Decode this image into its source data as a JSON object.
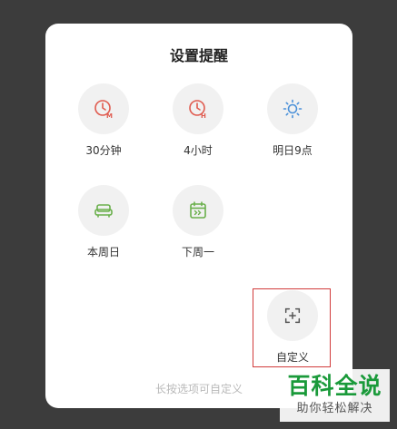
{
  "dialog": {
    "title": "设置提醒",
    "hint": "长按选项可自定义"
  },
  "options": [
    {
      "label": "30分钟",
      "icon": "clock-m-icon",
      "color": "#e05a4e"
    },
    {
      "label": "4小时",
      "icon": "clock-h-icon",
      "color": "#e05a4e"
    },
    {
      "label": "明日9点",
      "icon": "sun-icon",
      "color": "#4a90d9"
    },
    {
      "label": "本周日",
      "icon": "sofa-icon",
      "color": "#6ab04c"
    },
    {
      "label": "下周一",
      "icon": "calendar-next-icon",
      "color": "#6ab04c"
    },
    {
      "label": "自定义",
      "icon": "custom-add-icon",
      "color": "#555555"
    }
  ],
  "watermark": {
    "main": "百科全说",
    "sub": "助你轻松解决"
  }
}
